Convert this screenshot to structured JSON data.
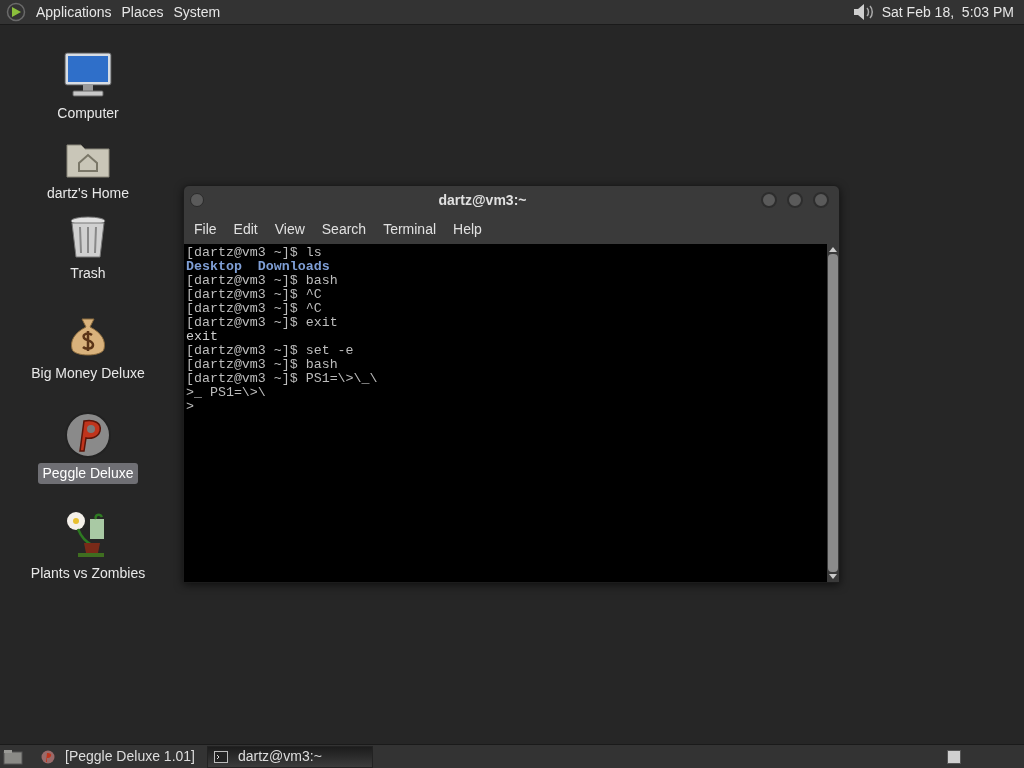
{
  "top_panel": {
    "menus": [
      "Applications",
      "Places",
      "System"
    ],
    "clock": "Sat Feb 18,  5:03 PM"
  },
  "desktop_icons": [
    {
      "kind": "computer",
      "label": "Computer",
      "selected": false
    },
    {
      "kind": "home",
      "label": "dartz's Home",
      "selected": false
    },
    {
      "kind": "trash",
      "label": "Trash",
      "selected": false
    },
    {
      "kind": "money",
      "label": "Big Money Deluxe",
      "selected": false
    },
    {
      "kind": "peggle",
      "label": "Peggle Deluxe",
      "selected": true
    },
    {
      "kind": "plant",
      "label": "Plants vs Zombies",
      "selected": false
    }
  ],
  "terminal": {
    "title": "dartz@vm3:~",
    "menu": [
      "File",
      "Edit",
      "View",
      "Search",
      "Terminal",
      "Help"
    ],
    "lines": [
      {
        "kind": "prompt",
        "text": "[dartz@vm3 ~]$ ls"
      },
      {
        "kind": "listing",
        "items": [
          "Desktop",
          "Downloads"
        ]
      },
      {
        "kind": "prompt",
        "text": "[dartz@vm3 ~]$ bash"
      },
      {
        "kind": "prompt",
        "text": "[dartz@vm3 ~]$ ^C"
      },
      {
        "kind": "prompt",
        "text": "[dartz@vm3 ~]$ ^C"
      },
      {
        "kind": "prompt",
        "text": "[dartz@vm3 ~]$ exit"
      },
      {
        "kind": "output",
        "text": "exit"
      },
      {
        "kind": "prompt",
        "text": "[dartz@vm3 ~]$ set -e"
      },
      {
        "kind": "prompt",
        "text": "[dartz@vm3 ~]$ bash"
      },
      {
        "kind": "prompt",
        "text": "[dartz@vm3 ~]$ PS1=\\>\\_\\"
      },
      {
        "kind": "prompt",
        "text": ">_ PS1=\\>\\"
      },
      {
        "kind": "prompt",
        "text": ">"
      }
    ]
  },
  "taskbar": [
    {
      "kind": "peggle",
      "label": "[Peggle Deluxe 1.01]",
      "selected": false
    },
    {
      "kind": "terminal",
      "label": "dartz@vm3:~",
      "selected": true
    }
  ]
}
